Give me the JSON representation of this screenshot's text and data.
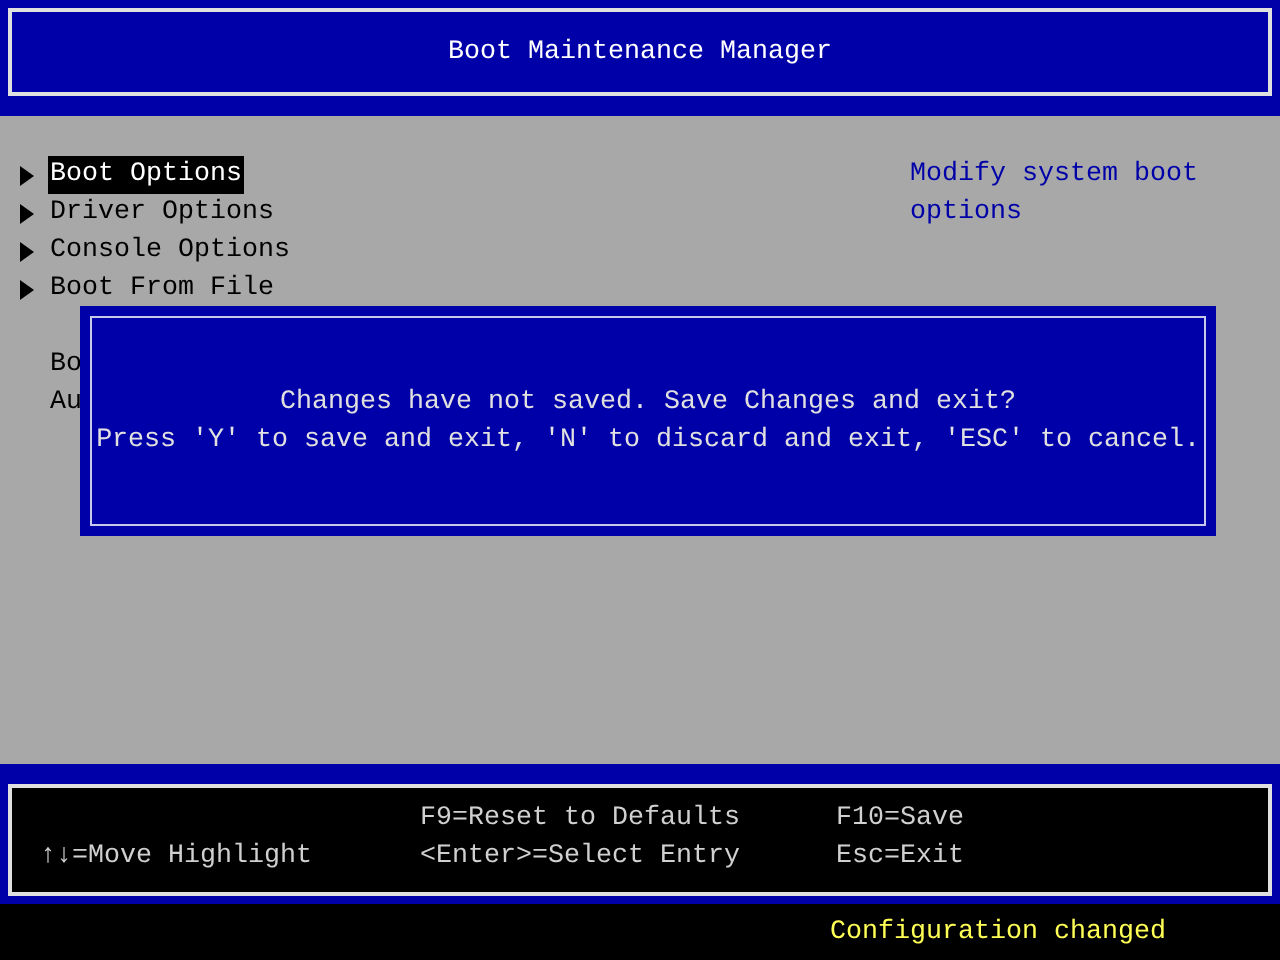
{
  "title": "Boot Maintenance Manager",
  "menu": [
    {
      "label": "Boot Options",
      "selected": true,
      "kind": "submenu"
    },
    {
      "label": "Driver Options",
      "selected": false,
      "kind": "submenu"
    },
    {
      "label": "Console Options",
      "selected": false,
      "kind": "submenu"
    },
    {
      "label": "Boot From File",
      "selected": false,
      "kind": "submenu"
    },
    {
      "label": "Bo",
      "selected": false,
      "kind": "spacer-before"
    },
    {
      "label": "Au",
      "selected": false,
      "kind": "plain"
    }
  ],
  "help": "Modify system boot options",
  "dialog": {
    "lines": [
      "Changes have not saved. Save Changes and exit?",
      "Press 'Y' to save and exit, 'N' to discard and exit, 'ESC' to cancel."
    ]
  },
  "footer": {
    "columns": [
      [
        "",
        "↑↓=Move Highlight"
      ],
      [
        "F9=Reset to Defaults",
        "<Enter>=Select Entry"
      ],
      [
        "F10=Save",
        "Esc=Exit"
      ]
    ]
  },
  "status": "Configuration changed"
}
